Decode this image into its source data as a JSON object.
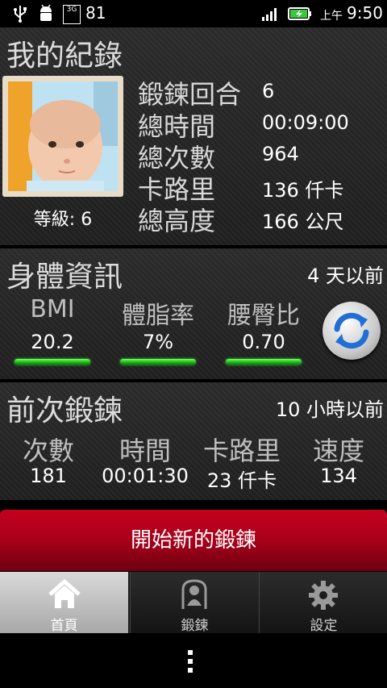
{
  "status_bar": {
    "notif_count": "81",
    "ampm": "上午",
    "time": "9:50",
    "net_type": "3G"
  },
  "record": {
    "title": "我的紀錄",
    "level": "等級: 6",
    "stats": [
      {
        "label": "鍛鍊回合",
        "value": "6"
      },
      {
        "label": "總時間",
        "value": "00:09:00"
      },
      {
        "label": "總次數",
        "value": "964"
      },
      {
        "label": "卡路里",
        "value": "136 仟卡"
      },
      {
        "label": "總高度",
        "value": "166 公尺"
      }
    ]
  },
  "body_info": {
    "title": "身體資訊",
    "updated": "4 天以前",
    "metrics": [
      {
        "label": "BMI",
        "value": "20.2"
      },
      {
        "label": "體脂率",
        "value": "7%"
      },
      {
        "label": "腰臀比",
        "value": "0.70"
      }
    ],
    "refresh_icon": "refresh-icon"
  },
  "last_workout": {
    "title": "前次鍛鍊",
    "updated": "10 小時以前",
    "metrics": [
      {
        "label": "次數",
        "value": "181"
      },
      {
        "label": "時間",
        "value": "00:01:30"
      },
      {
        "label": "卡路里",
        "value": "23 仟卡"
      },
      {
        "label": "速度",
        "value": "134"
      }
    ]
  },
  "start_button": "開始新的鍛鍊",
  "tabs": [
    {
      "label": "首頁",
      "icon": "home-icon"
    },
    {
      "label": "鍛鍊",
      "icon": "workout-icon"
    },
    {
      "label": "設定",
      "icon": "gear-icon"
    }
  ],
  "colors": {
    "accent_green": "#22cc22",
    "start_red": "#a8001a",
    "refresh_blue": "#1f6fd6"
  }
}
